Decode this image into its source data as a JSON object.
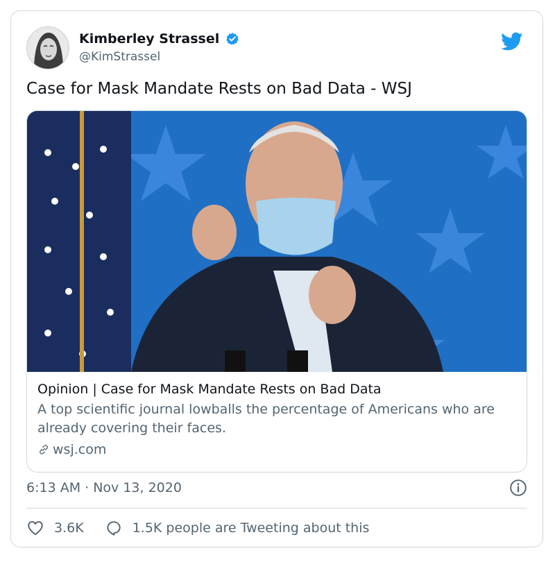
{
  "author": {
    "display_name": "Kimberley Strassel",
    "handle": "@KimStrassel"
  },
  "tweet": {
    "text": "Case for Mask Mandate Rests on Bad Data - WSJ",
    "timestamp": "6:13 AM · Nov 13, 2020"
  },
  "link_card": {
    "title": "Opinion | Case for Mask Mandate Rests on Bad Data",
    "description": "A top scientific journal lowballs the percentage of Americans who are already covering their faces.",
    "domain": "wsj.com"
  },
  "actions": {
    "likes": "3.6K",
    "tweeting": "1.5K people are Tweeting about this"
  },
  "icons": {
    "verified": "verified-badge-icon",
    "brand": "twitter-bird-icon",
    "link": "link-icon",
    "info": "info-icon",
    "like": "heart-icon",
    "reply": "speech-bubble-icon"
  },
  "colors": {
    "twitter_blue": "#1d9bf0",
    "secondary_text": "#536471",
    "border": "#cfd9de",
    "photo_background": "#1f6fc4"
  }
}
